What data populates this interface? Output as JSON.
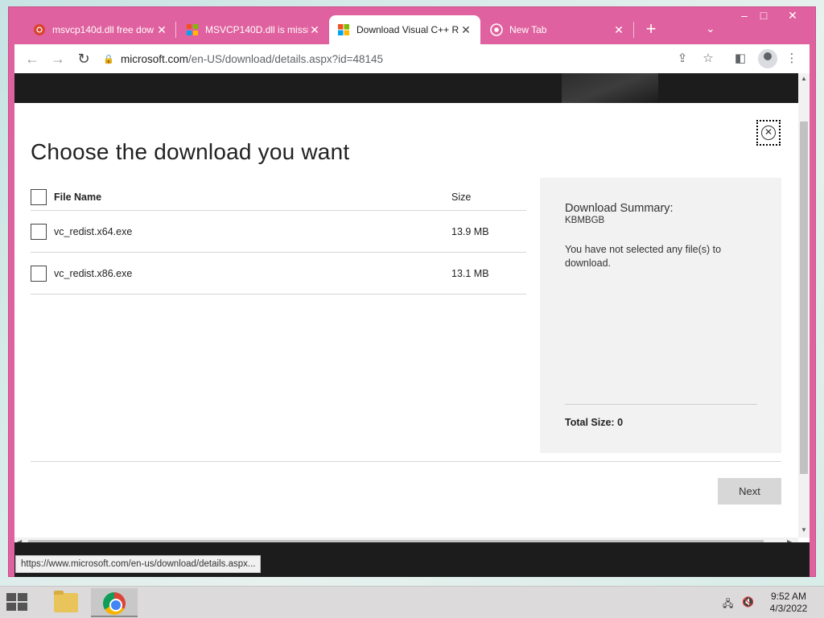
{
  "browser": {
    "tabs": [
      {
        "title": "msvcp140d.dll free dow",
        "active": false,
        "favicon": "red-circle-icon"
      },
      {
        "title": "MSVCP140D.dll is missi",
        "active": false,
        "favicon": "windows-logo-icon"
      },
      {
        "title": "Download Visual C++ R",
        "active": true,
        "favicon": "microsoft-logo-icon"
      },
      {
        "title": "New Tab",
        "active": false,
        "favicon": "chrome-icon"
      }
    ],
    "new_tab_glyph": "+",
    "tab_search_glyph": "⌄",
    "window_controls": {
      "minimize": "–",
      "maximize": "□",
      "close": "✕"
    },
    "address": {
      "host": "microsoft.com",
      "path": "/en-US/download/details.aspx?id=48145"
    }
  },
  "dialog": {
    "heading": "Choose the download you want",
    "close_glyph": "✕",
    "columns": {
      "name": "File Name",
      "size": "Size"
    },
    "files": [
      {
        "name": "vc_redist.x64.exe",
        "size": "13.9 MB"
      },
      {
        "name": "vc_redist.x86.exe",
        "size": "13.1 MB"
      }
    ],
    "summary": {
      "title": "Download Summary:",
      "code": "KBMBGB",
      "message": "You have not selected any file(s) to download.",
      "total_label": "Total Size: ",
      "total_value": "0"
    },
    "next_label": "Next"
  },
  "status_url": "https://www.microsoft.com/en-us/download/details.aspx...",
  "taskbar": {
    "time": "9:52 AM",
    "date": "4/3/2022"
  },
  "colors": {
    "browser_frame": "#e0619f",
    "dialog_bg": "#ffffff",
    "summary_bg": "#f2f2f2",
    "next_button": "#d7d7d7"
  }
}
